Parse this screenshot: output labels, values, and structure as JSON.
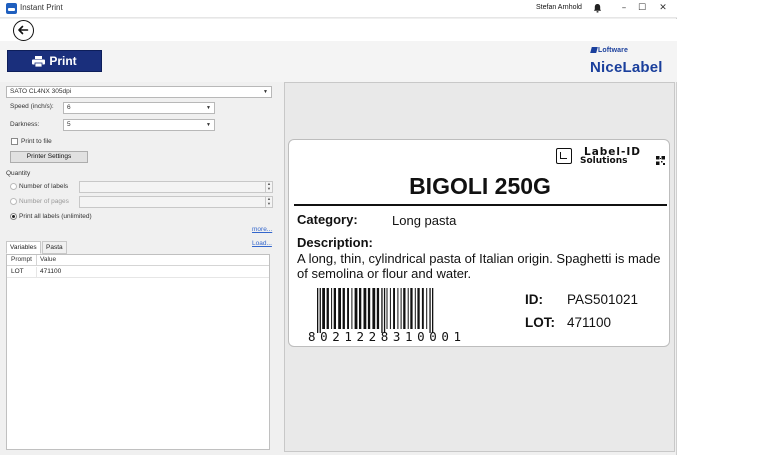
{
  "window": {
    "title": "Instant Print",
    "user": "Stefan Arnhold",
    "controls": {
      "minimize": "–",
      "maximize": "☐",
      "close": "✕"
    }
  },
  "header": {
    "print_label": "Print",
    "logo_small": "Loftware",
    "logo_big": "NiceLabel"
  },
  "settings": {
    "printer": "SATO CL4NX 305dpi",
    "speed_label": "Speed (inch/s):",
    "speed_value": "6",
    "darkness_label": "Darkness:",
    "darkness_value": "5",
    "print_to_file_label": "Print to file",
    "printer_settings_label": "Printer Settings"
  },
  "quantity": {
    "section_label": "Quantity",
    "number_of_labels": "Number of labels",
    "number_of_pages": "Number of pages",
    "print_all": "Print all labels (unlimited)",
    "selected": "print_all",
    "more_link": "more..."
  },
  "variables": {
    "tabs": [
      "Variables",
      "Pasta"
    ],
    "active_tab": "Variables",
    "load_link": "Load...",
    "columns": [
      "Prompt",
      "Value"
    ],
    "rows": [
      {
        "prompt": "LOT",
        "value": "471100"
      }
    ]
  },
  "label": {
    "brand_line1": "Label-ID",
    "brand_line2": "Solutions",
    "title": "BIGOLI 250G",
    "category_key": "Category:",
    "category_value": "Long pasta",
    "description_key": "Description:",
    "description_value": "A long, thin, cylindrical pasta of Italian origin. Spaghetti is made of semolina or flour and water.",
    "barcode_number": "8021228310001",
    "id_key": "ID:",
    "id_value": "PAS501021",
    "lot_key": "LOT:",
    "lot_value": "471100"
  },
  "icons": {
    "back": "back-arrow-icon",
    "printer": "printer-icon",
    "bell": "bell-icon",
    "qr": "qr-code-icon"
  },
  "colors": {
    "print_button": "#1a2f7c",
    "brand_blue": "#1a3f9c",
    "link": "#3366cc"
  }
}
